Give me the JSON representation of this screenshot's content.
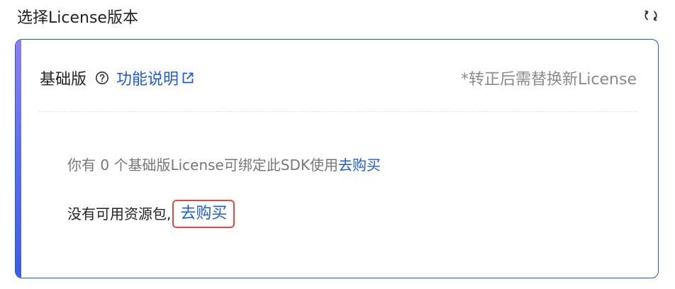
{
  "section": {
    "title": "选择License版本",
    "refresh_icon": "refresh-icon"
  },
  "card": {
    "plan_name": "基础版",
    "help_icon": "question-circle-icon",
    "feature_link": "功能说明",
    "external_icon": "external-link-icon",
    "note": "*转正后需替换新License",
    "license_info": {
      "prefix": "你有 0 个基础版License可绑定此SDK使用",
      "buy_label": "去购买"
    },
    "resource": {
      "text": "没有可用资源包,",
      "buy_label": "去购买"
    }
  },
  "colors": {
    "accent": "#1f5bd6",
    "highlight_border": "#e04848",
    "muted_text": "#8a8a8a"
  }
}
